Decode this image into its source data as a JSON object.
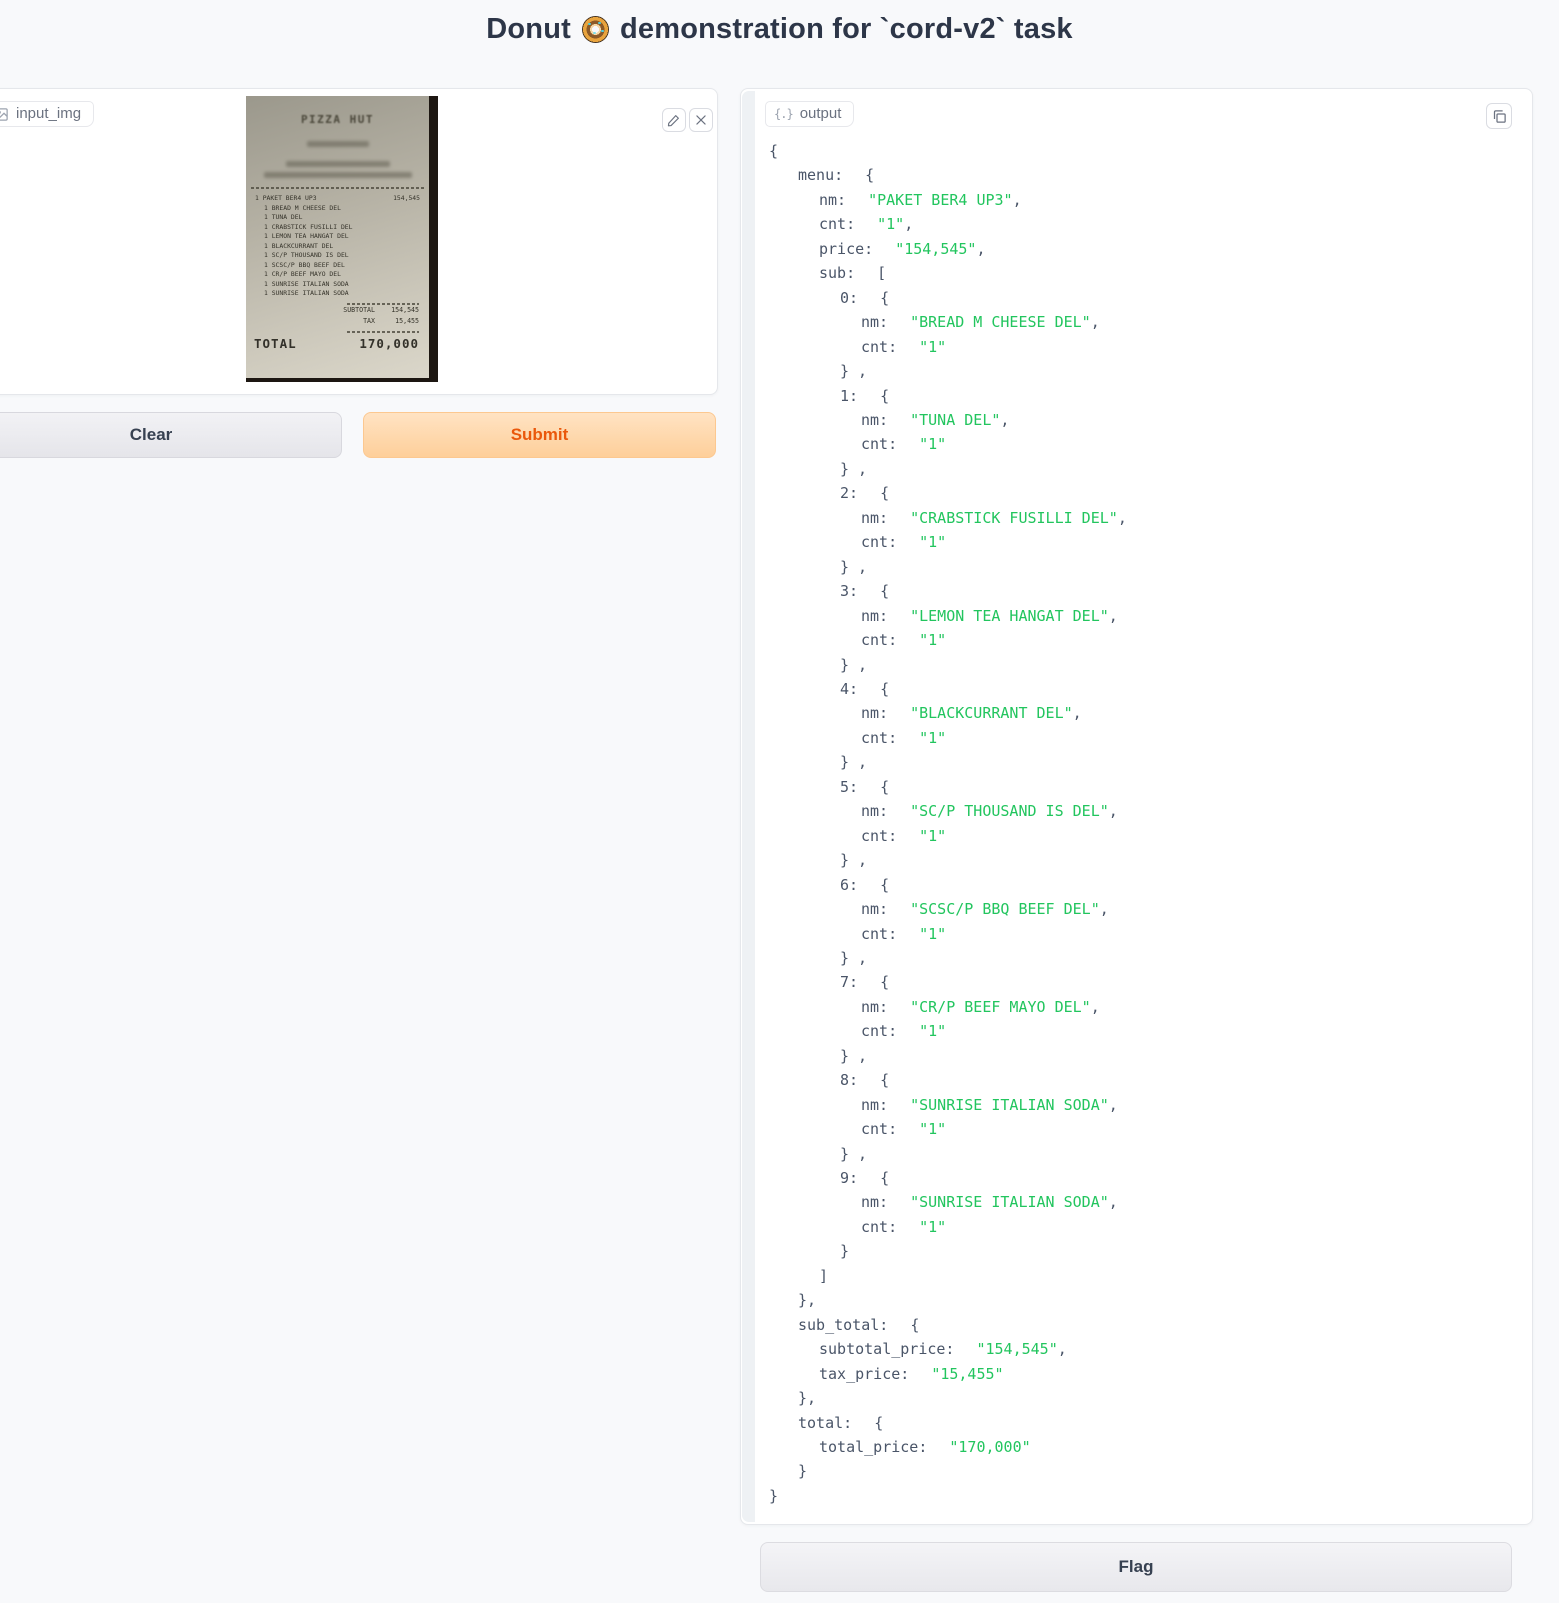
{
  "header": {
    "title_prefix": "Donut",
    "title_suffix": "demonstration for `cord-v2` task"
  },
  "input_panel": {
    "label": "input_img",
    "clear_button": "Clear",
    "submit_button": "Submit",
    "receipt": {
      "brand": "PIZZA HUT",
      "items": [
        {
          "qty": "1",
          "name": "PAKET BER4 UP3",
          "price": "154,545",
          "indent": false
        },
        {
          "qty": "1",
          "name": "BREAD M CHEESE DEL",
          "indent": true
        },
        {
          "qty": "1",
          "name": "TUNA DEL",
          "indent": true
        },
        {
          "qty": "1",
          "name": "CRABSTICK FUSILLI DEL",
          "indent": true
        },
        {
          "qty": "1",
          "name": "LEMON TEA HANGAT DEL",
          "indent": true
        },
        {
          "qty": "1",
          "name": "BLACKCURRANT DEL",
          "indent": true
        },
        {
          "qty": "1",
          "name": "SC/P THOUSAND IS DEL",
          "indent": true
        },
        {
          "qty": "1",
          "name": "SCSC/P BBQ BEEF DEL",
          "indent": true
        },
        {
          "qty": "1",
          "name": "CR/P BEEF MAYO DEL",
          "indent": true
        },
        {
          "qty": "1",
          "name": "SUNRISE ITALIAN SODA",
          "indent": true
        },
        {
          "qty": "1",
          "name": "SUNRISE ITALIAN SODA",
          "indent": true
        }
      ],
      "summary": {
        "subtotal_label": "SUBTOTAL",
        "subtotal_value": "154,545",
        "tax_label": "TAX",
        "tax_value": "15,455",
        "total_label": "TOTAL",
        "total_value": "170,000"
      }
    }
  },
  "output_panel": {
    "label": "output",
    "icon_glyph": "{.}",
    "flag_button": "Flag",
    "json": {
      "menu": {
        "nm": "PAKET BER4 UP3",
        "cnt": "1",
        "price": "154,545",
        "sub": [
          {
            "nm": "BREAD M CHEESE DEL",
            "cnt": "1"
          },
          {
            "nm": "TUNA DEL",
            "cnt": "1"
          },
          {
            "nm": "CRABSTICK FUSILLI DEL",
            "cnt": "1"
          },
          {
            "nm": "LEMON TEA HANGAT DEL",
            "cnt": "1"
          },
          {
            "nm": "BLACKCURRANT DEL",
            "cnt": "1"
          },
          {
            "nm": "SC/P THOUSAND IS DEL",
            "cnt": "1"
          },
          {
            "nm": "SCSC/P BBQ BEEF DEL",
            "cnt": "1"
          },
          {
            "nm": "CR/P BEEF MAYO DEL",
            "cnt": "1"
          },
          {
            "nm": "SUNRISE ITALIAN SODA",
            "cnt": "1"
          },
          {
            "nm": "SUNRISE ITALIAN SODA",
            "cnt": "1"
          }
        ]
      },
      "sub_total": {
        "subtotal_price": "154,545",
        "tax_price": "15,455"
      },
      "total": {
        "total_price": "170,000"
      }
    }
  },
  "colors": {
    "accent_orange": "#ea580c",
    "json_string_green": "#22c55e",
    "page_background": "#f8f9fb"
  }
}
